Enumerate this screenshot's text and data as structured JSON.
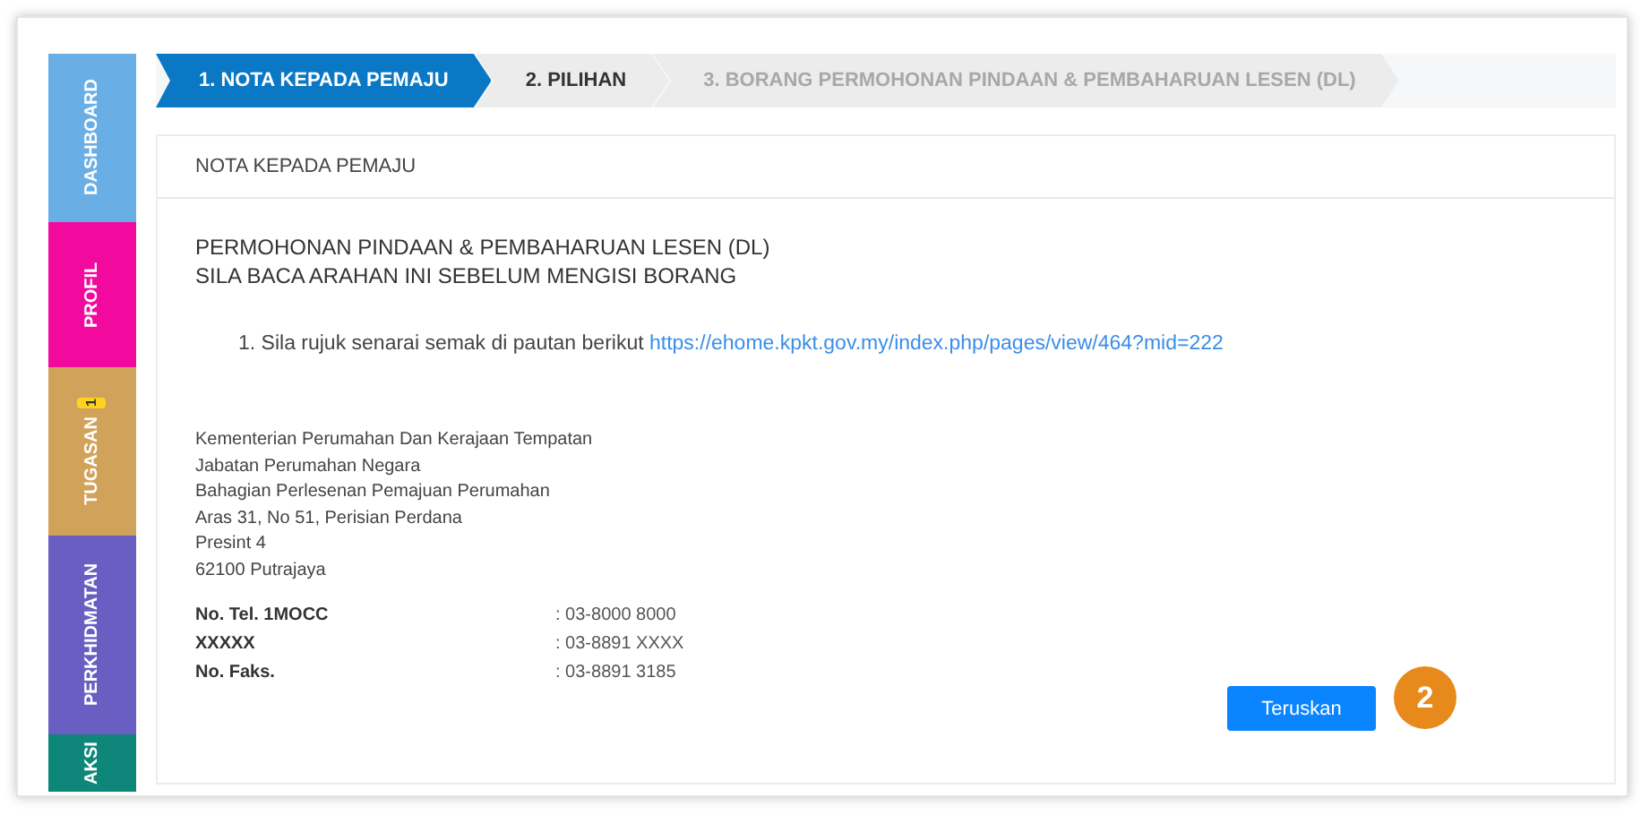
{
  "sidebar": {
    "items": [
      {
        "label": "DASHBOARD",
        "color": "#6aaee6"
      },
      {
        "label": "PROFIL",
        "color": "#f20a9e"
      },
      {
        "label": "TUGASAN",
        "color": "#d1a25a",
        "badge": "1"
      },
      {
        "label": "PERKHIDMATAN",
        "color": "#6b5ec2"
      },
      {
        "label": "AKSI",
        "color": "#0e877a"
      }
    ]
  },
  "steps": [
    {
      "label": "1. NOTA KEPADA PEMAJU",
      "selected": true,
      "disabled": false
    },
    {
      "label": "2. PILIHAN",
      "selected": false,
      "disabled": false
    },
    {
      "label": "3. BORANG PERMOHONAN PINDAAN & PEMBAHARUAN LESEN (DL)",
      "selected": false,
      "disabled": true
    }
  ],
  "card": {
    "header": "NOTA KEPADA PEMAJU",
    "title_lines": [
      "PERMOHONAN PINDAAN & PEMBAHARUAN LESEN (DL)",
      "SILA BACA ARAHAN INI SEBELUM MENGISI BORANG"
    ],
    "instruction": {
      "text": "1. Sila rujuk senarai semak di pautan berikut",
      "link": "https://ehome.kpkt.gov.my/index.php/pages/view/464?mid=222"
    },
    "address_lines": [
      "Kementerian Perumahan Dan Kerajaan Tempatan",
      "Jabatan Perumahan Negara",
      "Bahagian Perlesenan Pemajuan Perumahan",
      "Aras 31, No 51, Perisian Perdana",
      "Presint 4",
      "62100 Putrajaya"
    ],
    "contacts": [
      {
        "label": "No. Tel. 1MOCC",
        "value": ": 03-8000 8000"
      },
      {
        "label": "XXXXX",
        "value": ": 03-8891 XXXX"
      },
      {
        "label": "No. Faks.",
        "value": ": 03-8891 3185"
      }
    ],
    "button": "Teruskan",
    "callout": "2"
  }
}
